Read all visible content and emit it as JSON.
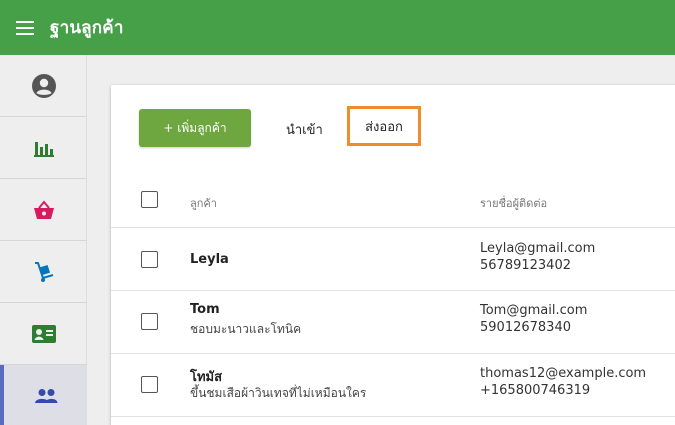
{
  "header": {
    "title": "ฐานลูกค้า",
    "accent": "#46a047"
  },
  "sidebar": {
    "items": [
      {
        "icon": "account-circle-icon",
        "color": "#555555"
      },
      {
        "icon": "bar-chart-icon",
        "color": "#2e7d32"
      },
      {
        "icon": "shopping-basket-icon",
        "color": "#d81b60"
      },
      {
        "icon": "hand-truck-icon",
        "color": "#0277bd"
      },
      {
        "icon": "contact-card-icon",
        "color": "#2e7d32"
      },
      {
        "icon": "people-icon",
        "color": "#3949ab",
        "active": true
      }
    ]
  },
  "toolbar": {
    "add_label": "+ เพิ่มลูกค้า",
    "import_label": "นำเข้า",
    "export_label": "ส่งออก",
    "add_color": "#6ea73f",
    "highlight_color": "#f08c2c"
  },
  "table": {
    "columns": [
      "ลูกค้า",
      "รายชื่อผู้ติดต่อ"
    ],
    "rows": [
      {
        "name": "Leyla",
        "note": "",
        "email": "Leyla@gmail.com",
        "phone": "56789123402"
      },
      {
        "name": "Tom",
        "note": "ชอบมะนาวและโทนิค",
        "email": "Tom@gmail.com",
        "phone": "59012678340"
      },
      {
        "name": "โทมัส",
        "note": "ขึ้นชมเสือผ้าวินเทจที่ไม่เหมือนใคร",
        "email": "thomas12@example.com",
        "phone": "+165800746319"
      }
    ]
  }
}
